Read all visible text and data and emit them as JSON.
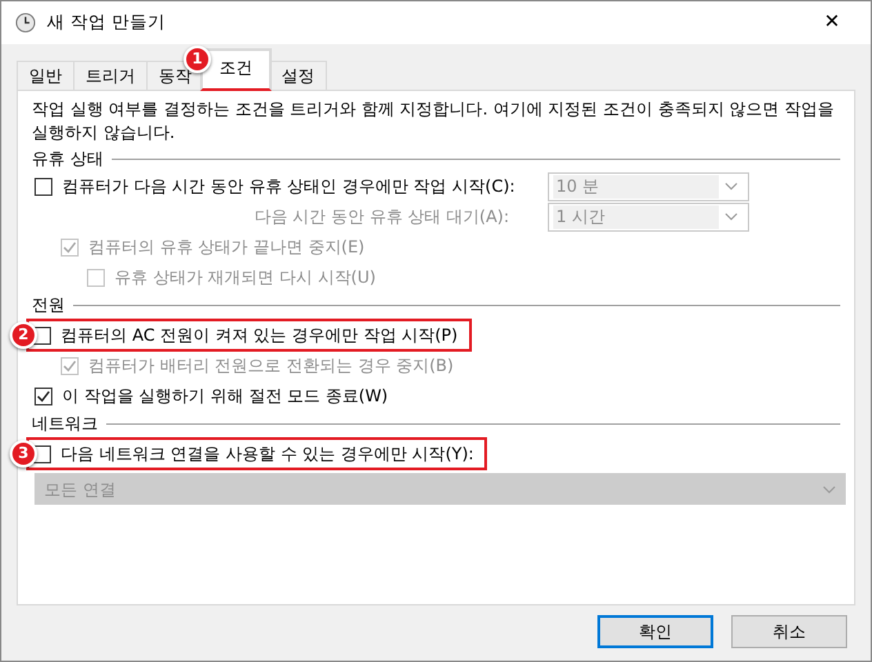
{
  "window": {
    "title": "새 작업 만들기",
    "close": "✕"
  },
  "tabs": [
    {
      "label": "일반",
      "selected": false
    },
    {
      "label": "트리거",
      "selected": false
    },
    {
      "label": "동작",
      "selected": false
    },
    {
      "label": "조건",
      "selected": true,
      "callout": "1"
    },
    {
      "label": "설정",
      "selected": false
    }
  ],
  "description": "작업 실행 여부를 결정하는 조건을 트리거와 함께 지정합니다. 여기에 지정된 조건이 충족되지 않으면 작업을 실행하지 않습니다.",
  "sections": [
    {
      "heading": "유휴 상태",
      "items": [
        {
          "kind": "checkbox",
          "label": "컴퓨터가 다음 시간 동안 유휴 상태인 경우에만 작업 시작(C):",
          "checked": false,
          "disabled": false,
          "dropdown": {
            "value": "10 분",
            "disabled": true
          },
          "children": [
            {
              "kind": "label",
              "label": "다음 시간 동안 유휴 상태 대기(A):",
              "disabled": true,
              "dropdown": {
                "value": "1 시간",
                "disabled": true
              }
            },
            {
              "kind": "checkbox",
              "label": "컴퓨터의 유휴 상태가 끝나면 중지(E)",
              "checked": true,
              "disabled": true,
              "children": [
                {
                  "kind": "checkbox",
                  "label": "유휴 상태가 재개되면 다시 시작(U)",
                  "checked": false,
                  "disabled": true
                }
              ]
            }
          ]
        }
      ]
    },
    {
      "heading": "전원",
      "items": [
        {
          "kind": "checkbox",
          "label": "컴퓨터의 AC 전원이 켜져 있는 경우에만 작업 시작(P)",
          "checked": false,
          "disabled": false,
          "callout": "2",
          "children": [
            {
              "kind": "checkbox",
              "label": "컴퓨터가 배터리 전원으로 전환되는 경우 중지(B)",
              "checked": true,
              "disabled": true
            }
          ]
        },
        {
          "kind": "checkbox",
          "label": "이 작업을 실행하기 위해 절전 모드 종료(W)",
          "checked": true,
          "disabled": false
        }
      ]
    },
    {
      "heading": "네트워크",
      "items": [
        {
          "kind": "checkbox",
          "label": "다음 네트워크 연결을 사용할 수 있는 경우에만 시작(Y):",
          "checked": false,
          "disabled": false,
          "callout": "3"
        },
        {
          "kind": "select",
          "value": "모든 연결",
          "disabled": true
        }
      ]
    }
  ],
  "buttons": [
    {
      "label": "확인",
      "default": true
    },
    {
      "label": "취소",
      "default": false
    }
  ]
}
